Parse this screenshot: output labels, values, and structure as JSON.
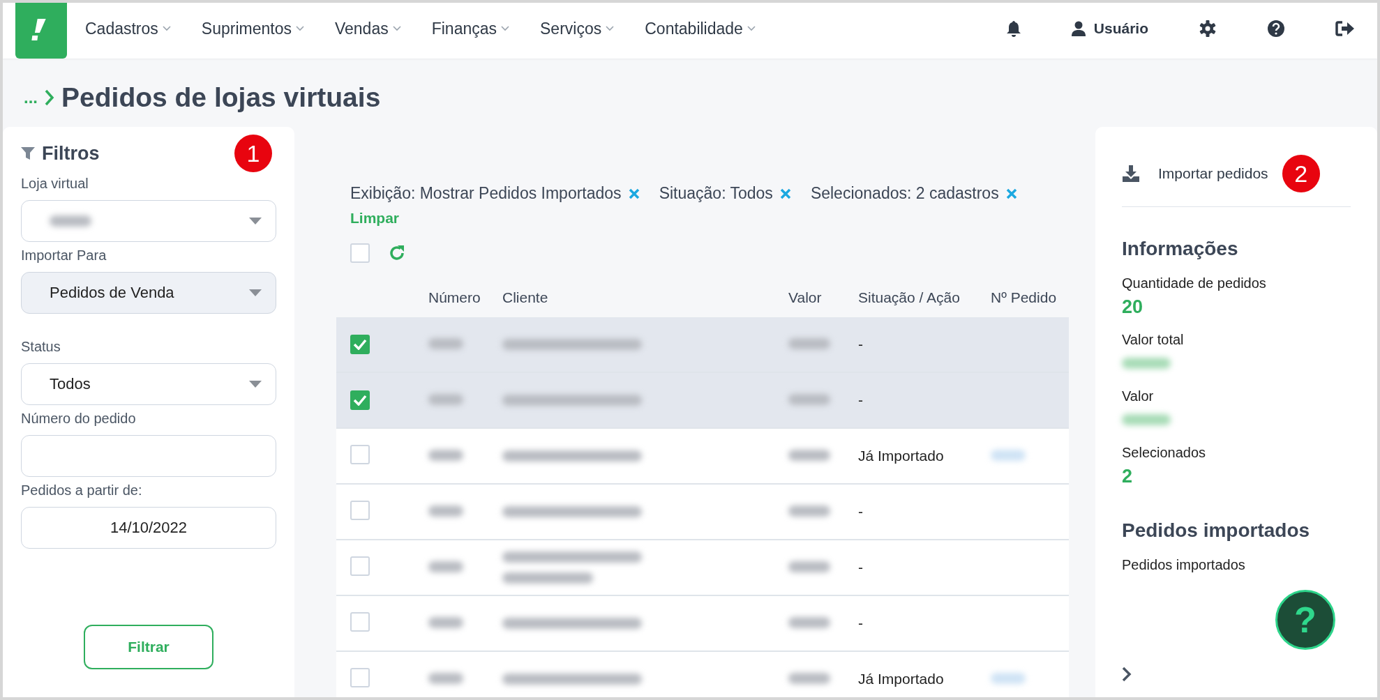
{
  "nav": {
    "items": [
      {
        "label": "Cadastros"
      },
      {
        "label": "Suprimentos"
      },
      {
        "label": "Vendas"
      },
      {
        "label": "Finanças"
      },
      {
        "label": "Serviços"
      },
      {
        "label": "Contabilidade"
      }
    ],
    "user": "Usuário"
  },
  "breadcrumb": {
    "ellipsis": "...",
    "title": "Pedidos de lojas virtuais"
  },
  "filters": {
    "title": "Filtros",
    "badge": "1",
    "fields": [
      {
        "kind": "select",
        "label": "Loja virtual",
        "value_blurred": true
      },
      {
        "kind": "select",
        "label": "Importar Para",
        "value": "Pedidos de Venda",
        "disabled": true
      },
      {
        "kind": "select",
        "label": "Status",
        "value": "Todos",
        "disabled": false
      },
      {
        "kind": "input",
        "label": "Número do pedido"
      },
      {
        "kind": "input",
        "label": "Pedidos a partir de:",
        "value": "14/10/2022"
      }
    ],
    "button": "Filtrar"
  },
  "chips": [
    {
      "label": "Exibição: Mostrar Pedidos Importados"
    },
    {
      "label": "Situação: Todos"
    },
    {
      "label": "Selecionados: 2 cadastros"
    }
  ],
  "clear": "Limpar",
  "select_all": {
    "checked": false
  },
  "table": {
    "columns": [
      "Número",
      "Cliente",
      "Valor",
      "Situação / Ação",
      "Nº Pedido"
    ],
    "rows": [
      {
        "selected": true,
        "status": "-",
        "order_blurred": false,
        "client_wrapped": false
      },
      {
        "selected": true,
        "status": "-",
        "order_blurred": false,
        "client_wrapped": false
      },
      {
        "selected": false,
        "status": "Já Importado",
        "order_blurred": true,
        "client_wrapped": false
      },
      {
        "selected": false,
        "status": "-",
        "order_blurred": false,
        "client_wrapped": false
      },
      {
        "selected": false,
        "status": "-",
        "order_blurred": false,
        "client_wrapped": true
      },
      {
        "selected": false,
        "status": "-",
        "order_blurred": false,
        "client_wrapped": false
      },
      {
        "selected": false,
        "status": "Já Importado",
        "order_blurred": true,
        "client_wrapped": false
      }
    ]
  },
  "side": {
    "action": "Importar pedidos",
    "badge": "2",
    "info_title": "Informações",
    "stats": [
      {
        "label": "Quantidade de pedidos",
        "value": "20"
      },
      {
        "label": "Valor total",
        "value_blurred": true
      },
      {
        "label": "Valor",
        "value_blurred": true
      },
      {
        "label": "Selecionados",
        "value": "2"
      }
    ],
    "imported_title": "Pedidos importados",
    "imported_text": "Pedidos importados"
  },
  "help": "?"
}
